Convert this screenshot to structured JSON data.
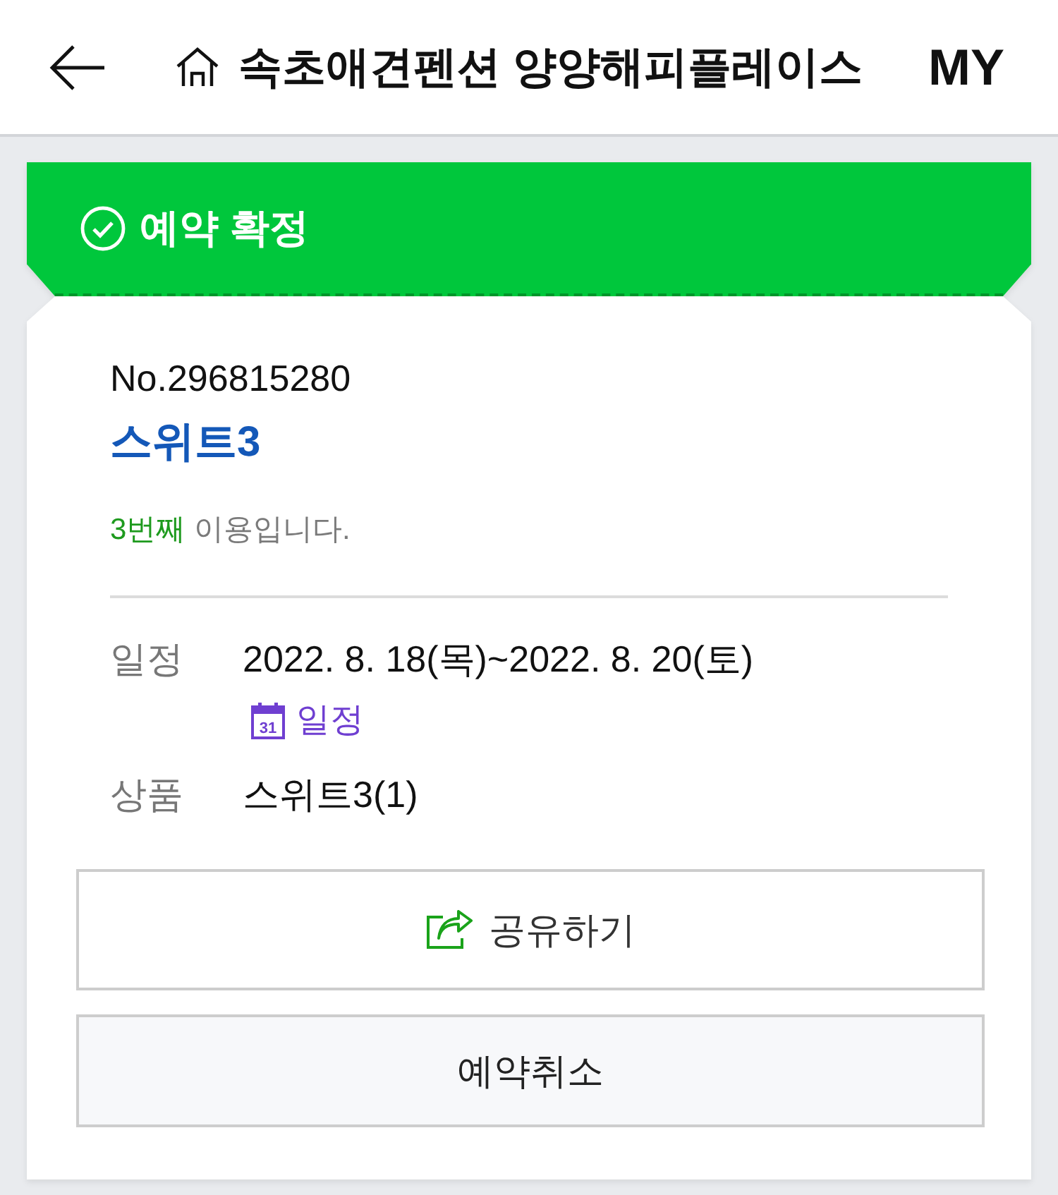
{
  "header": {
    "title": "속초애견펜션 양양해피플레이스",
    "my_link": "MY"
  },
  "status": {
    "label": "예약 확정",
    "kind": "confirmed"
  },
  "booking": {
    "number": "No.296815280",
    "room": "스위트3",
    "visit": {
      "count": "3번째",
      "text": "이용입니다."
    }
  },
  "details": [
    {
      "label": "일정",
      "value": "2022. 8. 18(목)~2022. 8. 20(토)",
      "link": {
        "day": "31",
        "label": "일정"
      }
    },
    {
      "label": "상품",
      "value": "스위트3(1)"
    }
  ],
  "buttons": [
    {
      "label": "공유하기",
      "kind": "share"
    },
    {
      "label": "예약취소",
      "kind": "cancel"
    }
  ]
}
